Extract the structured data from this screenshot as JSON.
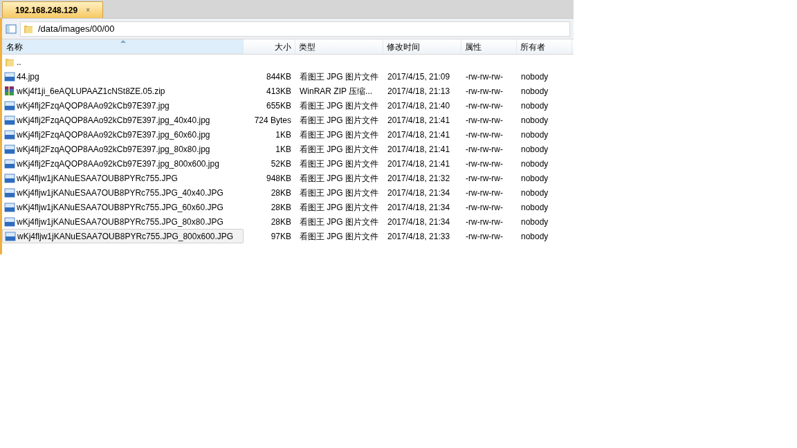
{
  "tabs": [
    {
      "label": "192.168.248.129",
      "close": "×",
      "selected": true
    }
  ],
  "path": "/data/images/00/00",
  "columns": [
    {
      "label": "名称",
      "sorted": true
    },
    {
      "label": "大小",
      "sorted": false
    },
    {
      "label": "类型",
      "sorted": false
    },
    {
      "label": "修改时间",
      "sorted": false
    },
    {
      "label": "属性",
      "sorted": false
    },
    {
      "label": "所有者",
      "sorted": false
    }
  ],
  "rows": [
    {
      "kind": "folder",
      "name": "..",
      "selected": false
    },
    {
      "kind": "jpg",
      "name": "44.jpg",
      "size": "844KB",
      "type": "看图王 JPG 图片文件",
      "modified": "2017/4/15, 21:09",
      "attributes": "-rw-rw-rw-",
      "owner": "nobody",
      "selected": false
    },
    {
      "kind": "zip",
      "name": "wKj4f1ji_6eAQLUPAAZ1cNSt8ZE.05.zip",
      "size": "413KB",
      "type": "WinRAR ZIP 压缩...",
      "modified": "2017/4/18, 21:13",
      "attributes": "-rw-rw-rw-",
      "owner": "nobody",
      "selected": false
    },
    {
      "kind": "jpg",
      "name": "wKj4flj2FzqAQOP8AAo92kCb97E397.jpg",
      "size": "655KB",
      "type": "看图王 JPG 图片文件",
      "modified": "2017/4/18, 21:40",
      "attributes": "-rw-rw-rw-",
      "owner": "nobody",
      "selected": false
    },
    {
      "kind": "jpg",
      "name": "wKj4flj2FzqAQOP8AAo92kCb97E397.jpg_40x40.jpg",
      "size": "724 Bytes",
      "type": "看图王 JPG 图片文件",
      "modified": "2017/4/18, 21:41",
      "attributes": "-rw-rw-rw-",
      "owner": "nobody",
      "selected": false
    },
    {
      "kind": "jpg",
      "name": "wKj4flj2FzqAQOP8AAo92kCb97E397.jpg_60x60.jpg",
      "size": "1KB",
      "type": "看图王 JPG 图片文件",
      "modified": "2017/4/18, 21:41",
      "attributes": "-rw-rw-rw-",
      "owner": "nobody",
      "selected": false
    },
    {
      "kind": "jpg",
      "name": "wKj4flj2FzqAQOP8AAo92kCb97E397.jpg_80x80.jpg",
      "size": "1KB",
      "type": "看图王 JPG 图片文件",
      "modified": "2017/4/18, 21:41",
      "attributes": "-rw-rw-rw-",
      "owner": "nobody",
      "selected": false
    },
    {
      "kind": "jpg",
      "name": "wKj4flj2FzqAQOP8AAo92kCb97E397.jpg_800x600.jpg",
      "size": "52KB",
      "type": "看图王 JPG 图片文件",
      "modified": "2017/4/18, 21:41",
      "attributes": "-rw-rw-rw-",
      "owner": "nobody",
      "selected": false
    },
    {
      "kind": "jpg",
      "name": "wKj4fljw1jKANuESAA7OUB8PYRc755.JPG",
      "size": "948KB",
      "type": "看图王 JPG 图片文件",
      "modified": "2017/4/18, 21:32",
      "attributes": "-rw-rw-rw-",
      "owner": "nobody",
      "selected": false
    },
    {
      "kind": "jpg",
      "name": "wKj4fljw1jKANuESAA7OUB8PYRc755.JPG_40x40.JPG",
      "size": "28KB",
      "type": "看图王 JPG 图片文件",
      "modified": "2017/4/18, 21:34",
      "attributes": "-rw-rw-rw-",
      "owner": "nobody",
      "selected": false
    },
    {
      "kind": "jpg",
      "name": "wKj4fljw1jKANuESAA7OUB8PYRc755.JPG_60x60.JPG",
      "size": "28KB",
      "type": "看图王 JPG 图片文件",
      "modified": "2017/4/18, 21:34",
      "attributes": "-rw-rw-rw-",
      "owner": "nobody",
      "selected": false
    },
    {
      "kind": "jpg",
      "name": "wKj4fljw1jKANuESAA7OUB8PYRc755.JPG_80x80.JPG",
      "size": "28KB",
      "type": "看图王 JPG 图片文件",
      "modified": "2017/4/18, 21:34",
      "attributes": "-rw-rw-rw-",
      "owner": "nobody",
      "selected": false
    },
    {
      "kind": "jpg",
      "name": "wKj4fljw1jKANuESAA7OUB8PYRc755.JPG_800x600.JPG",
      "size": "97KB",
      "type": "看图王 JPG 图片文件",
      "modified": "2017/4/18, 21:33",
      "attributes": "-rw-rw-rw-",
      "owner": "nobody",
      "selected": true
    }
  ]
}
